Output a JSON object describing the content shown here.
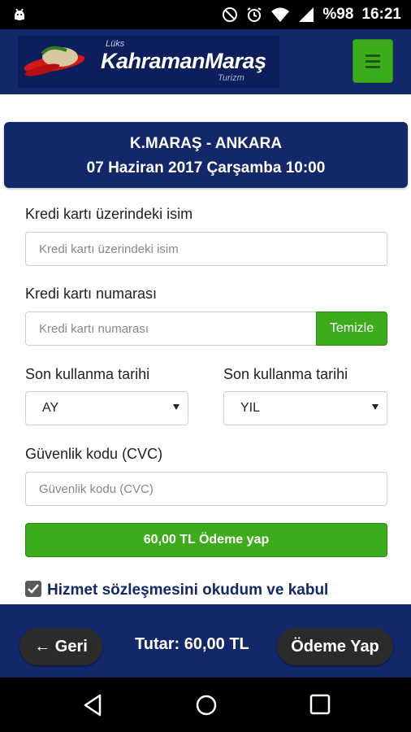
{
  "status_bar": {
    "battery": "%98",
    "time": "16:21",
    "icons": [
      "android-icon",
      "do-not-disturb-icon",
      "alarm-icon",
      "wifi-icon",
      "signal-icon",
      "battery-icon"
    ]
  },
  "header": {
    "logo_small": "Lüks",
    "logo_brand": "KahramanMaraş",
    "logo_sub": "Turizm",
    "menu_icon": "hamburger-icon"
  },
  "trip": {
    "route": "K.MARAŞ - ANKARA",
    "datetime": "07 Haziran 2017 Çarşamba 10:00"
  },
  "form": {
    "card_name_label": "Kredi kartı üzerindeki isim",
    "card_name_placeholder": "Kredi kartı üzerindeki isim",
    "card_number_label": "Kredi kartı numarası",
    "card_number_placeholder": "Kredi kartı numarası",
    "clear_label": "Temizle",
    "expiry_month_label": "Son kullanma tarihi",
    "expiry_month_value": "AY",
    "expiry_year_label": "Son kullanma tarihi",
    "expiry_year_value": "YIL",
    "cvc_label": "Güvenlik kodu (CVC)",
    "cvc_placeholder": "Güvenlik kodu (CVC)",
    "pay_label": "60,00 TL Ödeme yap",
    "terms_label": "Hizmet sözleşmesini okudum ve kabul",
    "terms_checked": true
  },
  "footer": {
    "back_label": "← Geri",
    "total_label": "Tutar: 60,00 TL",
    "pay_label": "Ödeme Yap"
  },
  "colors": {
    "primary": "#13286a",
    "accent_green": "#3cac1d",
    "dark_button": "#2b2b2b"
  }
}
